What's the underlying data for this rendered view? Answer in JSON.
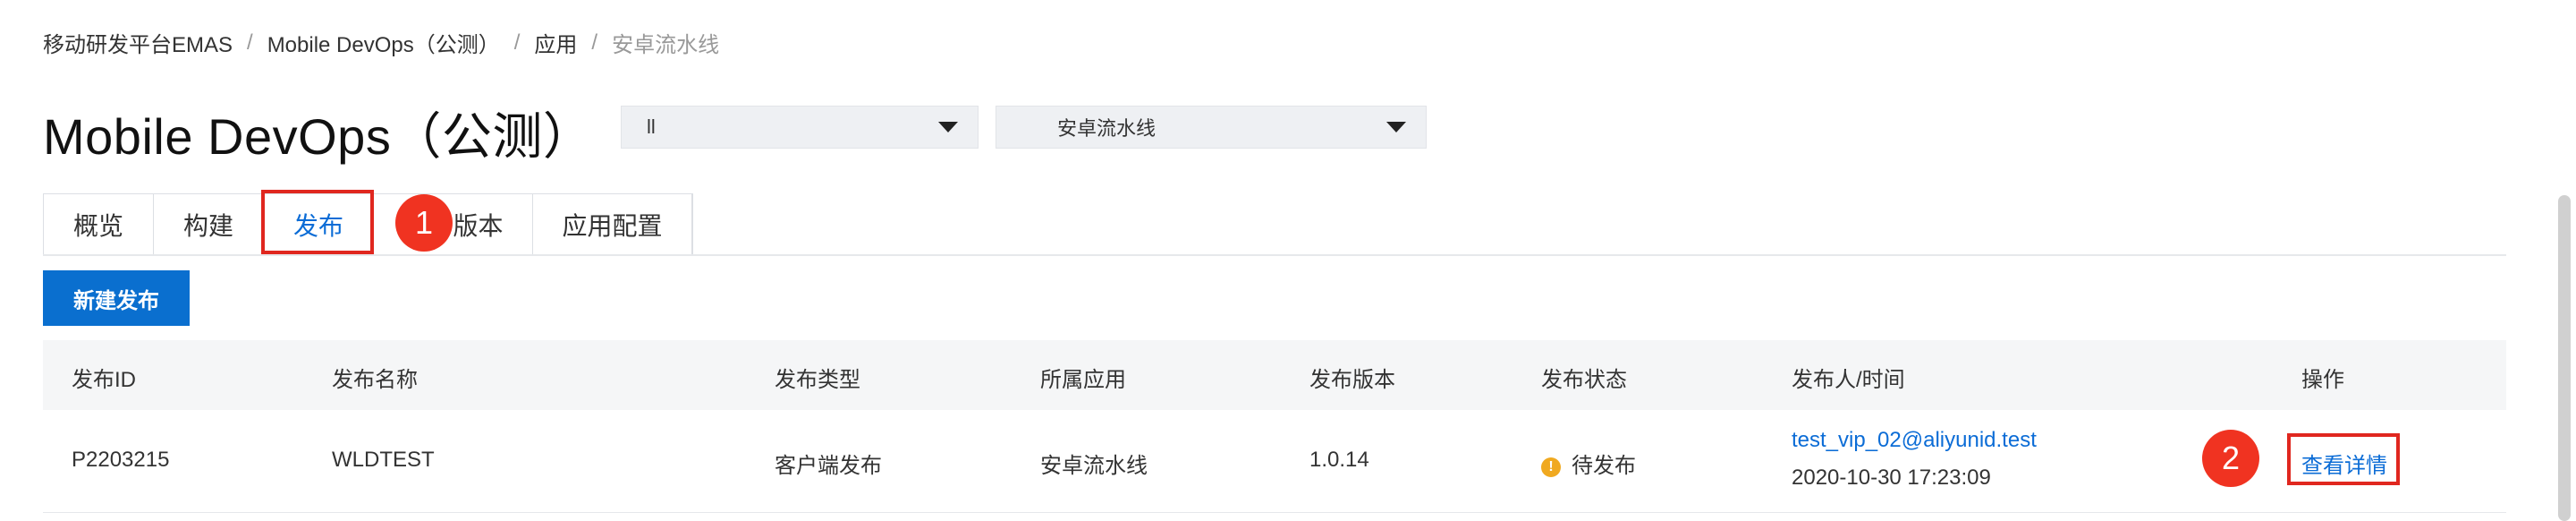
{
  "breadcrumb": {
    "items": [
      "移动研发平台EMAS",
      "Mobile DevOps（公测）",
      "应用"
    ],
    "current": "安卓流水线",
    "separator": "/"
  },
  "page": {
    "title": "Mobile DevOps（公测）"
  },
  "selects": {
    "app_group": {
      "value": "ll"
    },
    "pipeline": {
      "value": "安卓流水线"
    }
  },
  "tabs": [
    {
      "label": "概览"
    },
    {
      "label": "构建"
    },
    {
      "label": "发布"
    },
    {
      "label": "版本"
    },
    {
      "label": "应用配置"
    }
  ],
  "active_tab": "发布",
  "markers": {
    "one": "1",
    "two": "2"
  },
  "toolbar": {
    "new_release_label": "新建发布"
  },
  "table": {
    "headers": [
      "发布ID",
      "发布名称",
      "发布类型",
      "所属应用",
      "发布版本",
      "发布状态",
      "发布人/时间",
      "操作"
    ],
    "rows": [
      {
        "id": "P2203215",
        "name": "WLDTEST",
        "type": "客户端发布",
        "app": "安卓流水线",
        "version": "1.0.14",
        "status": "待发布",
        "status_icon": "!",
        "publisher_email": "test_vip_02@aliyunid.test",
        "publish_time": "2020-10-30 17:23:09",
        "action_label": "查看详情"
      }
    ]
  },
  "colors": {
    "accent": "#0a6fcf",
    "link": "#0b6cd6",
    "highlight": "#e0271f",
    "warning": "#f0a920"
  }
}
